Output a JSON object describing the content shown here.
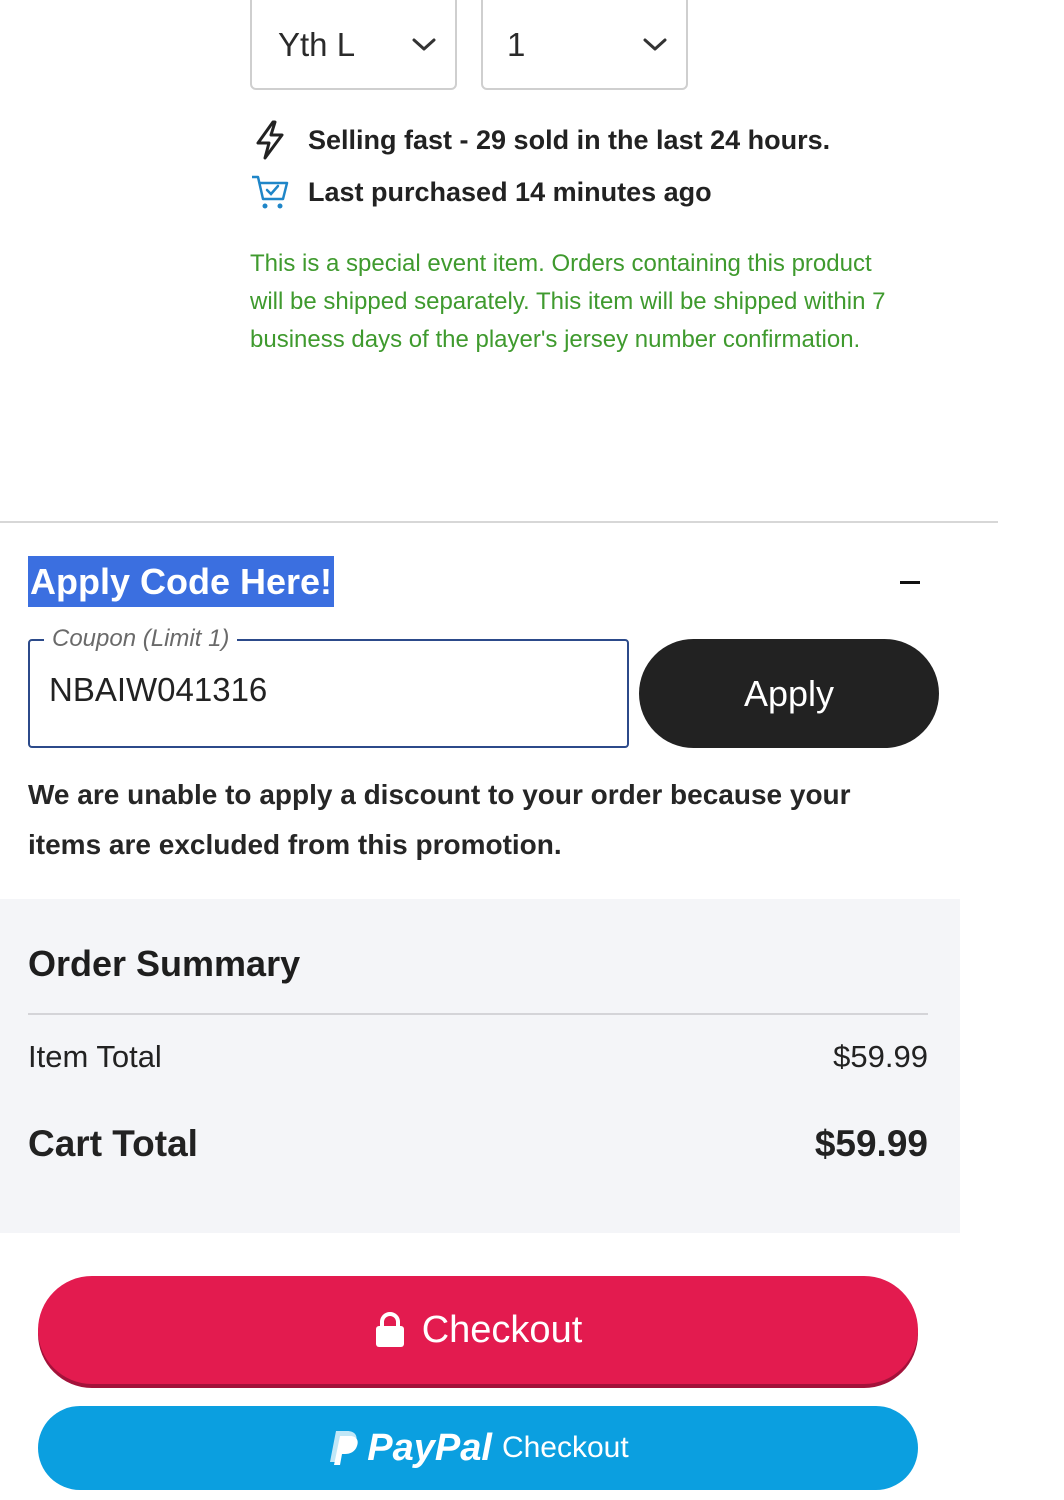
{
  "product": {
    "size_select": {
      "value": "Yth L"
    },
    "quantity_select": {
      "value": "1"
    },
    "urgency": {
      "selling_fast": "Selling fast - 29 sold in the last 24 hours.",
      "last_purchased": "Last purchased 14 minutes ago"
    },
    "special_notice": "This is a special event item. Orders containing this product will be shipped separately. This item will be shipped within 7 business days of the player's jersey number confirmation."
  },
  "coupon": {
    "heading": "Apply Code Here!",
    "label": "Coupon (Limit 1)",
    "value": "NBAIW041316",
    "apply_label": "Apply",
    "error_message": "We are unable to apply a discount to your order because your items are excluded from this promotion."
  },
  "order_summary": {
    "title": "Order Summary",
    "item_total_label": "Item Total",
    "item_total_value": "$59.99",
    "cart_total_label": "Cart Total",
    "cart_total_value": "$59.99"
  },
  "actions": {
    "checkout_label": "Checkout",
    "paypal_brand": "PayPal",
    "paypal_label": "Checkout"
  },
  "colors": {
    "notice_green": "#3f9a2e",
    "checkout_red": "#e31b4f",
    "paypal_blue": "#0b9fe0",
    "apply_dark": "#222222",
    "highlight_blue": "#3b6fe0"
  },
  "icons": {
    "urgency_1": "lightning-icon",
    "urgency_2": "cart-icon",
    "checkout": "lock-icon",
    "paypal": "paypal-logo-icon"
  }
}
